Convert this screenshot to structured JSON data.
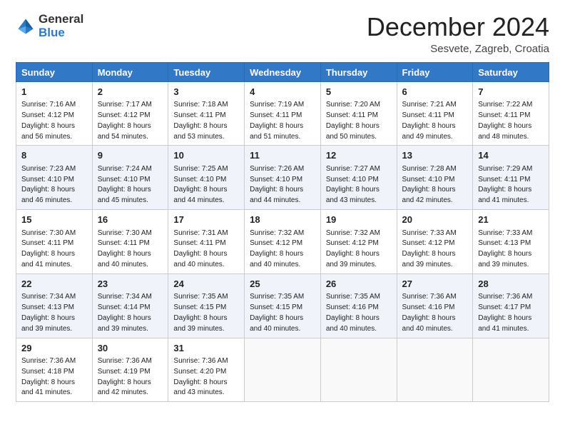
{
  "logo": {
    "general": "General",
    "blue": "Blue"
  },
  "title": "December 2024",
  "location": "Sesvete, Zagreb, Croatia",
  "days_header": [
    "Sunday",
    "Monday",
    "Tuesday",
    "Wednesday",
    "Thursday",
    "Friday",
    "Saturday"
  ],
  "weeks": [
    [
      {
        "day": "1",
        "sunrise": "7:16 AM",
        "sunset": "4:12 PM",
        "daylight": "8 hours and 56 minutes."
      },
      {
        "day": "2",
        "sunrise": "7:17 AM",
        "sunset": "4:12 PM",
        "daylight": "8 hours and 54 minutes."
      },
      {
        "day": "3",
        "sunrise": "7:18 AM",
        "sunset": "4:11 PM",
        "daylight": "8 hours and 53 minutes."
      },
      {
        "day": "4",
        "sunrise": "7:19 AM",
        "sunset": "4:11 PM",
        "daylight": "8 hours and 51 minutes."
      },
      {
        "day": "5",
        "sunrise": "7:20 AM",
        "sunset": "4:11 PM",
        "daylight": "8 hours and 50 minutes."
      },
      {
        "day": "6",
        "sunrise": "7:21 AM",
        "sunset": "4:11 PM",
        "daylight": "8 hours and 49 minutes."
      },
      {
        "day": "7",
        "sunrise": "7:22 AM",
        "sunset": "4:11 PM",
        "daylight": "8 hours and 48 minutes."
      }
    ],
    [
      {
        "day": "8",
        "sunrise": "7:23 AM",
        "sunset": "4:10 PM",
        "daylight": "8 hours and 46 minutes."
      },
      {
        "day": "9",
        "sunrise": "7:24 AM",
        "sunset": "4:10 PM",
        "daylight": "8 hours and 45 minutes."
      },
      {
        "day": "10",
        "sunrise": "7:25 AM",
        "sunset": "4:10 PM",
        "daylight": "8 hours and 44 minutes."
      },
      {
        "day": "11",
        "sunrise": "7:26 AM",
        "sunset": "4:10 PM",
        "daylight": "8 hours and 44 minutes."
      },
      {
        "day": "12",
        "sunrise": "7:27 AM",
        "sunset": "4:10 PM",
        "daylight": "8 hours and 43 minutes."
      },
      {
        "day": "13",
        "sunrise": "7:28 AM",
        "sunset": "4:10 PM",
        "daylight": "8 hours and 42 minutes."
      },
      {
        "day": "14",
        "sunrise": "7:29 AM",
        "sunset": "4:11 PM",
        "daylight": "8 hours and 41 minutes."
      }
    ],
    [
      {
        "day": "15",
        "sunrise": "7:30 AM",
        "sunset": "4:11 PM",
        "daylight": "8 hours and 41 minutes."
      },
      {
        "day": "16",
        "sunrise": "7:30 AM",
        "sunset": "4:11 PM",
        "daylight": "8 hours and 40 minutes."
      },
      {
        "day": "17",
        "sunrise": "7:31 AM",
        "sunset": "4:11 PM",
        "daylight": "8 hours and 40 minutes."
      },
      {
        "day": "18",
        "sunrise": "7:32 AM",
        "sunset": "4:12 PM",
        "daylight": "8 hours and 40 minutes."
      },
      {
        "day": "19",
        "sunrise": "7:32 AM",
        "sunset": "4:12 PM",
        "daylight": "8 hours and 39 minutes."
      },
      {
        "day": "20",
        "sunrise": "7:33 AM",
        "sunset": "4:12 PM",
        "daylight": "8 hours and 39 minutes."
      },
      {
        "day": "21",
        "sunrise": "7:33 AM",
        "sunset": "4:13 PM",
        "daylight": "8 hours and 39 minutes."
      }
    ],
    [
      {
        "day": "22",
        "sunrise": "7:34 AM",
        "sunset": "4:13 PM",
        "daylight": "8 hours and 39 minutes."
      },
      {
        "day": "23",
        "sunrise": "7:34 AM",
        "sunset": "4:14 PM",
        "daylight": "8 hours and 39 minutes."
      },
      {
        "day": "24",
        "sunrise": "7:35 AM",
        "sunset": "4:15 PM",
        "daylight": "8 hours and 39 minutes."
      },
      {
        "day": "25",
        "sunrise": "7:35 AM",
        "sunset": "4:15 PM",
        "daylight": "8 hours and 40 minutes."
      },
      {
        "day": "26",
        "sunrise": "7:35 AM",
        "sunset": "4:16 PM",
        "daylight": "8 hours and 40 minutes."
      },
      {
        "day": "27",
        "sunrise": "7:36 AM",
        "sunset": "4:16 PM",
        "daylight": "8 hours and 40 minutes."
      },
      {
        "day": "28",
        "sunrise": "7:36 AM",
        "sunset": "4:17 PM",
        "daylight": "8 hours and 41 minutes."
      }
    ],
    [
      {
        "day": "29",
        "sunrise": "7:36 AM",
        "sunset": "4:18 PM",
        "daylight": "8 hours and 41 minutes."
      },
      {
        "day": "30",
        "sunrise": "7:36 AM",
        "sunset": "4:19 PM",
        "daylight": "8 hours and 42 minutes."
      },
      {
        "day": "31",
        "sunrise": "7:36 AM",
        "sunset": "4:20 PM",
        "daylight": "8 hours and 43 minutes."
      },
      null,
      null,
      null,
      null
    ]
  ]
}
